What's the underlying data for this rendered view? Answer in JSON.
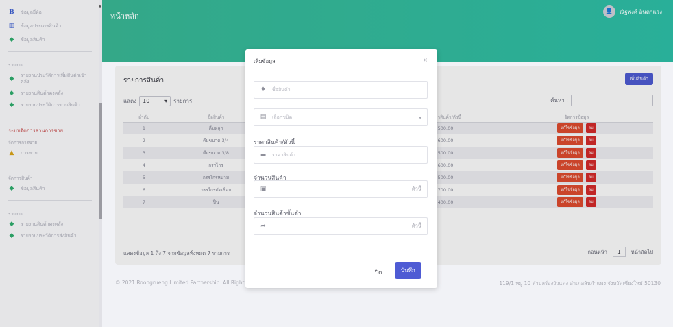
{
  "sidebar": {
    "top_items": [
      {
        "icon": "b-icon",
        "label": "ข้อมูลยี่ห้อ"
      },
      {
        "icon": "books-icon",
        "label": "ข้อมูลประเภทสินค้า"
      },
      {
        "icon": "leaf-icon",
        "label": "ข้อมูลสินค้า"
      }
    ],
    "report_heading": "รายงาน",
    "report_items": [
      {
        "label": "รายงานประวัติการเพิ่มสินค้าเข้าคลัง"
      },
      {
        "label": "รายงานสินค้าคงคลัง"
      },
      {
        "label": "รายงานประวัติการขายสินค้า"
      }
    ],
    "sales_system": "ระบบจัดการสานการขาย",
    "sales_heading": "จัดการการขาย",
    "sales_item": "การขาย",
    "product_heading": "จัดการสินค้า",
    "product_item": "ข้อมูลสินค้า",
    "report2_heading": "รายงาน",
    "report2_items": [
      {
        "label": "รายงานสินค้าคงคลัง"
      },
      {
        "label": "รายงานประวัติการส่งสินค้า"
      }
    ]
  },
  "header": {
    "title": "หน้าหลัก",
    "user_name": "ณัฐพงศ์ อินตาแวง"
  },
  "card": {
    "title": "รายการสินค้า",
    "add_button": "เพิ่มสินค้า",
    "show_label": "แสดง",
    "show_value": "10",
    "records_label": "รายการ",
    "search_label": "ค้นหา :",
    "columns": [
      "ลำดับ",
      "ชื่อสินค้า",
      "",
      "ราคาสินค้า/ตัวนี้",
      "จัดการข้อมูล"
    ],
    "rows": [
      {
        "no": "1",
        "name": "คีมหลุก",
        "price": "500.00"
      },
      {
        "no": "2",
        "name": "คีมขนาด 3/4",
        "price": "600.00"
      },
      {
        "no": "3",
        "name": "คีมขนาด 3/8",
        "price": "500.00"
      },
      {
        "no": "4",
        "name": "กรรไกร",
        "price": "600.00"
      },
      {
        "no": "5",
        "name": "กรรไกรหนาม",
        "price": "500.00"
      },
      {
        "no": "6",
        "name": "กรรไกรตัดเชือก",
        "price": "700.00"
      },
      {
        "no": "7",
        "name": "ปืน",
        "price": "400.00"
      }
    ],
    "edit_label": "แก้ไขข้อมูล",
    "delete_label": "ลบ",
    "info": "แสดงข้อมูล 1 ถึง 7 จากข้อมูลทั้งหมด 7 รายการ",
    "prev": "ก่อนหน้า",
    "page": "1",
    "next": "หน้าถัดไป"
  },
  "footer": {
    "left": "© 2021 Roongrueng Limited Partnership. All Rights Reserved.",
    "right": "119/1 หมู่ 10 ตำบลร้องวัวแดง อำเภอสันกำแพง จังหวัดเชียงใหม่ 50130"
  },
  "modal": {
    "title": "เพิ่มข้อมูล",
    "close_x": "×",
    "name_placeholder": "ชื่อสินค้า",
    "type_placeholder": "เลือกชนิด",
    "price_label": "ราคาสินค้า/ตัวนี้",
    "price_placeholder": "ราคาสินค้า",
    "qty_label": "จำนวนสินค้า",
    "qty_unit": "ตัวนี้",
    "min_label": "จำนวนสินค้าขั้นต่ำ",
    "min_unit": "ตัวนี้",
    "close_button": "ปิด",
    "save_button": "บันทึก"
  }
}
